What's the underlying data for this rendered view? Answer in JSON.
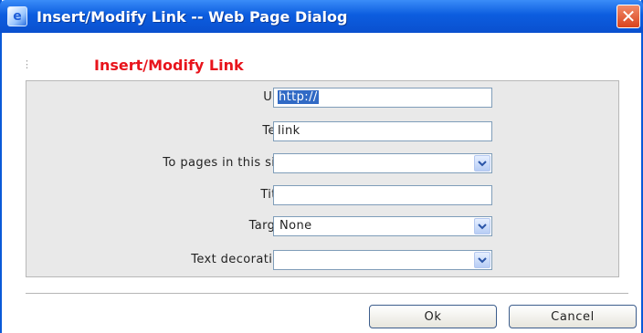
{
  "window": {
    "title": "Insert/Modify Link -- Web Page Dialog"
  },
  "dialog": {
    "heading": "Insert/Modify Link",
    "fields": {
      "url": {
        "label": "URL:",
        "value": "http://"
      },
      "text": {
        "label": "Text:",
        "value": "link"
      },
      "pages": {
        "label": "To pages in this site:",
        "value": ""
      },
      "title": {
        "label": "Title:",
        "value": ""
      },
      "target": {
        "label": "Target:",
        "value": "None"
      },
      "decoration": {
        "label": "Text decoration:",
        "value": ""
      }
    },
    "buttons": {
      "ok": "Ok",
      "cancel": "Cancel"
    }
  },
  "icons": [
    "ie-app-icon",
    "close-icon",
    "drag-handle-icon",
    "chevron-down-icon"
  ],
  "colors": {
    "titlebar": "#0c5ddf",
    "heading": "#e8141c",
    "panel": "#e9e9e9",
    "close": "#d9431c"
  }
}
